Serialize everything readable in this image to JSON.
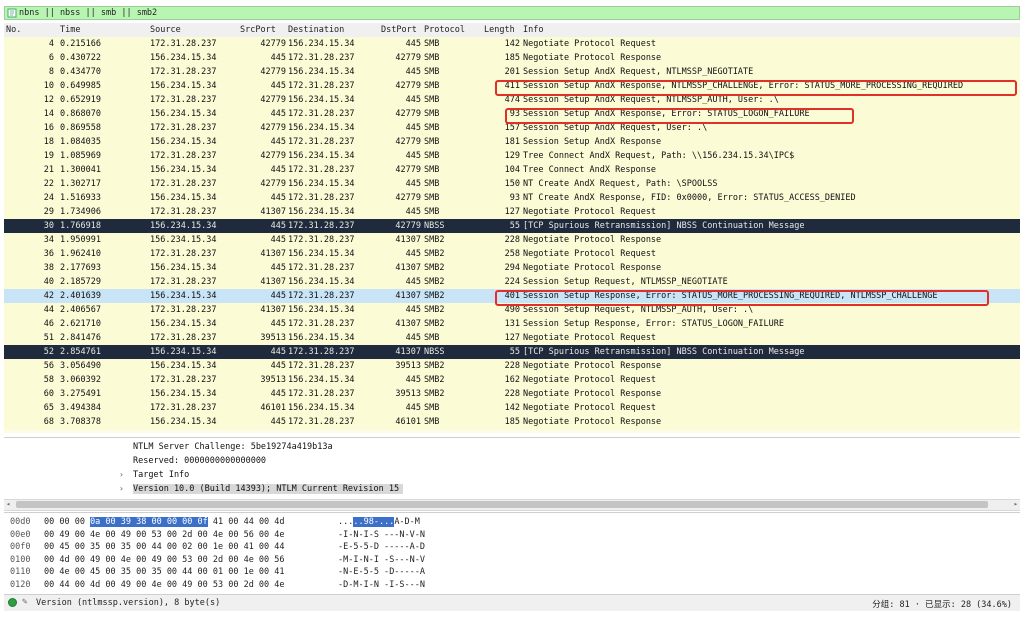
{
  "filter": {
    "text": "nbns || nbss || smb || smb2"
  },
  "columns": [
    "No.",
    "Time",
    "Source",
    "SrcPort",
    "Destination",
    "DstPort",
    "Protocol",
    "Length",
    "Info"
  ],
  "packets": [
    {
      "no": "4",
      "time": "0.215166",
      "src": "172.31.28.237",
      "sport": "42779",
      "dst": "156.234.15.34",
      "dport": "445",
      "proto": "SMB",
      "len": "142",
      "info": "Negotiate Protocol Request",
      "style": "smb"
    },
    {
      "no": "6",
      "time": "0.430722",
      "src": "156.234.15.34",
      "sport": "445",
      "dst": "172.31.28.237",
      "dport": "42779",
      "proto": "SMB",
      "len": "185",
      "info": "Negotiate Protocol Response",
      "style": "smb"
    },
    {
      "no": "8",
      "time": "0.434770",
      "src": "172.31.28.237",
      "sport": "42779",
      "dst": "156.234.15.34",
      "dport": "445",
      "proto": "SMB",
      "len": "201",
      "info": "Session Setup AndX Request, NTLMSSP_NEGOTIATE",
      "style": "smb"
    },
    {
      "no": "10",
      "time": "0.649985",
      "src": "156.234.15.34",
      "sport": "445",
      "dst": "172.31.28.237",
      "dport": "42779",
      "proto": "SMB",
      "len": "411",
      "info": "Session Setup AndX Response, NTLMSSP_CHALLENGE, Error: STATUS_MORE_PROCESSING_REQUIRED",
      "style": "smb"
    },
    {
      "no": "12",
      "time": "0.652919",
      "src": "172.31.28.237",
      "sport": "42779",
      "dst": "156.234.15.34",
      "dport": "445",
      "proto": "SMB",
      "len": "474",
      "info": "Session Setup AndX Request, NTLMSSP_AUTH, User: .\\",
      "style": "smb"
    },
    {
      "no": "14",
      "time": "0.868070",
      "src": "156.234.15.34",
      "sport": "445",
      "dst": "172.31.28.237",
      "dport": "42779",
      "proto": "SMB",
      "len": "93",
      "info": "Session Setup AndX Response, Error: STATUS_LOGON_FAILURE",
      "style": "smb"
    },
    {
      "no": "16",
      "time": "0.869558",
      "src": "172.31.28.237",
      "sport": "42779",
      "dst": "156.234.15.34",
      "dport": "445",
      "proto": "SMB",
      "len": "157",
      "info": "Session Setup AndX Request, User: .\\",
      "style": "smb"
    },
    {
      "no": "18",
      "time": "1.084035",
      "src": "156.234.15.34",
      "sport": "445",
      "dst": "172.31.28.237",
      "dport": "42779",
      "proto": "SMB",
      "len": "181",
      "info": "Session Setup AndX Response",
      "style": "smb"
    },
    {
      "no": "19",
      "time": "1.085969",
      "src": "172.31.28.237",
      "sport": "42779",
      "dst": "156.234.15.34",
      "dport": "445",
      "proto": "SMB",
      "len": "129",
      "info": "Tree Connect AndX Request, Path: \\\\156.234.15.34\\IPC$",
      "style": "smb"
    },
    {
      "no": "21",
      "time": "1.300041",
      "src": "156.234.15.34",
      "sport": "445",
      "dst": "172.31.28.237",
      "dport": "42779",
      "proto": "SMB",
      "len": "104",
      "info": "Tree Connect AndX Response",
      "style": "smb"
    },
    {
      "no": "22",
      "time": "1.302717",
      "src": "172.31.28.237",
      "sport": "42779",
      "dst": "156.234.15.34",
      "dport": "445",
      "proto": "SMB",
      "len": "150",
      "info": "NT Create AndX Request, Path: \\SPOOLSS",
      "style": "smb"
    },
    {
      "no": "24",
      "time": "1.516933",
      "src": "156.234.15.34",
      "sport": "445",
      "dst": "172.31.28.237",
      "dport": "42779",
      "proto": "SMB",
      "len": "93",
      "info": "NT Create AndX Response, FID: 0x0000, Error: STATUS_ACCESS_DENIED",
      "style": "smb"
    },
    {
      "no": "29",
      "time": "1.734906",
      "src": "172.31.28.237",
      "sport": "41307",
      "dst": "156.234.15.34",
      "dport": "445",
      "proto": "SMB",
      "len": "127",
      "info": "Negotiate Protocol Request",
      "style": "smb"
    },
    {
      "no": "30",
      "time": "1.766918",
      "src": "156.234.15.34",
      "sport": "445",
      "dst": "172.31.28.237",
      "dport": "42779",
      "proto": "NBSS",
      "len": "55",
      "info": "[TCP Spurious Retransmission] NBSS Continuation Message",
      "style": "dark"
    },
    {
      "no": "34",
      "time": "1.950991",
      "src": "156.234.15.34",
      "sport": "445",
      "dst": "172.31.28.237",
      "dport": "41307",
      "proto": "SMB2",
      "len": "228",
      "info": "Negotiate Protocol Response",
      "style": "smb"
    },
    {
      "no": "36",
      "time": "1.962410",
      "src": "172.31.28.237",
      "sport": "41307",
      "dst": "156.234.15.34",
      "dport": "445",
      "proto": "SMB2",
      "len": "258",
      "info": "Negotiate Protocol Request",
      "style": "smb"
    },
    {
      "no": "38",
      "time": "2.177693",
      "src": "156.234.15.34",
      "sport": "445",
      "dst": "172.31.28.237",
      "dport": "41307",
      "proto": "SMB2",
      "len": "294",
      "info": "Negotiate Protocol Response",
      "style": "smb"
    },
    {
      "no": "40",
      "time": "2.185729",
      "src": "172.31.28.237",
      "sport": "41307",
      "dst": "156.234.15.34",
      "dport": "445",
      "proto": "SMB2",
      "len": "224",
      "info": "Session Setup Request, NTLMSSP_NEGOTIATE",
      "style": "smb"
    },
    {
      "no": "42",
      "time": "2.401639",
      "src": "156.234.15.34",
      "sport": "445",
      "dst": "172.31.28.237",
      "dport": "41307",
      "proto": "SMB2",
      "len": "401",
      "info": "Session Setup Response, Error: STATUS_MORE_PROCESSING_REQUIRED, NTLMSSP_CHALLENGE",
      "style": "sel"
    },
    {
      "no": "44",
      "time": "2.406567",
      "src": "172.31.28.237",
      "sport": "41307",
      "dst": "156.234.15.34",
      "dport": "445",
      "proto": "SMB2",
      "len": "490",
      "info": "Session Setup Request, NTLMSSP_AUTH, User: .\\",
      "style": "smb"
    },
    {
      "no": "46",
      "time": "2.621710",
      "src": "156.234.15.34",
      "sport": "445",
      "dst": "172.31.28.237",
      "dport": "41307",
      "proto": "SMB2",
      "len": "131",
      "info": "Session Setup Response, Error: STATUS_LOGON_FAILURE",
      "style": "smb"
    },
    {
      "no": "51",
      "time": "2.841476",
      "src": "172.31.28.237",
      "sport": "39513",
      "dst": "156.234.15.34",
      "dport": "445",
      "proto": "SMB",
      "len": "127",
      "info": "Negotiate Protocol Request",
      "style": "smb"
    },
    {
      "no": "52",
      "time": "2.854761",
      "src": "156.234.15.34",
      "sport": "445",
      "dst": "172.31.28.237",
      "dport": "41307",
      "proto": "NBSS",
      "len": "55",
      "info": "[TCP Spurious Retransmission] NBSS Continuation Message",
      "style": "dark"
    },
    {
      "no": "56",
      "time": "3.056490",
      "src": "156.234.15.34",
      "sport": "445",
      "dst": "172.31.28.237",
      "dport": "39513",
      "proto": "SMB2",
      "len": "228",
      "info": "Negotiate Protocol Response",
      "style": "smb"
    },
    {
      "no": "58",
      "time": "3.060392",
      "src": "172.31.28.237",
      "sport": "39513",
      "dst": "156.234.15.34",
      "dport": "445",
      "proto": "SMB2",
      "len": "162",
      "info": "Negotiate Protocol Request",
      "style": "smb"
    },
    {
      "no": "60",
      "time": "3.275491",
      "src": "156.234.15.34",
      "sport": "445",
      "dst": "172.31.28.237",
      "dport": "39513",
      "proto": "SMB2",
      "len": "228",
      "info": "Negotiate Protocol Response",
      "style": "smb"
    },
    {
      "no": "65",
      "time": "3.494384",
      "src": "172.31.28.237",
      "sport": "46101",
      "dst": "156.234.15.34",
      "dport": "445",
      "proto": "SMB",
      "len": "142",
      "info": "Negotiate Protocol Request",
      "style": "smb"
    },
    {
      "no": "68",
      "time": "3.708378",
      "src": "156.234.15.34",
      "sport": "445",
      "dst": "172.31.28.237",
      "dport": "46101",
      "proto": "SMB",
      "len": "185",
      "info": "Negotiate Protocol Response",
      "style": "smb"
    }
  ],
  "detail": {
    "challenge": "NTLM Server Challenge: 5be19274a419b13a",
    "reserved": "Reserved: 0000000000000000",
    "target_info": "Target Info",
    "version": "Version 10.0 (Build 14393); NTLM Current Revision 15"
  },
  "hex": [
    {
      "off": "00d0",
      "pre": "00 00 00 ",
      "sel": "0a 00 39 38 00 00 00 0f",
      "post": " 41 00 44 00 4d",
      "apre": "...",
      "asel": "..98-...",
      "apost": "A-D-M"
    },
    {
      "off": "00e0",
      "pre": "00 49 00 4e 00 49 00 53  00 2d 00 4e 00 56 00 4e",
      "sel": "",
      "post": "",
      "apre": "-I-N-I-S -",
      "asel": "",
      "apost": "--N-V-N"
    },
    {
      "off": "00f0",
      "pre": "00 45 00 35 00 35 00 44  00 02 00 1e 00 41 00 44",
      "sel": "",
      "post": "",
      "apre": "-E-5-5-D -",
      "asel": "",
      "apost": "----A-D"
    },
    {
      "off": "0100",
      "pre": "00 4d 00 49 00 4e 00 49  00 53 00 2d 00 4e 00 56",
      "sel": "",
      "post": "",
      "apre": "-M-I-N-I -",
      "asel": "",
      "apost": "S---N-V"
    },
    {
      "off": "0110",
      "pre": "00 4e 00 45 00 35 00 35  00 44 00 01 00 1e 00 41",
      "sel": "",
      "post": "",
      "apre": "-N-E-5-5 -",
      "asel": "",
      "apost": "D-----A"
    },
    {
      "off": "0120",
      "pre": "00 44 00 4d 00 49 00 4e  00 49 00 53 00 2d 00 4e",
      "sel": "",
      "post": "",
      "apre": "-D-M-I-N -",
      "asel": "",
      "apost": "I-S---N"
    }
  ],
  "status": {
    "field": "Version (ntlmssp.version), 8 byte(s)",
    "right": "分组: 81 · 已显示: 28 (34.6%)"
  },
  "colors": {
    "highlight_box": "#e0302a",
    "dark_row": "#1f2b3c",
    "selected_row": "#c9e4f7",
    "filter_bg": "#b8f5b2"
  }
}
